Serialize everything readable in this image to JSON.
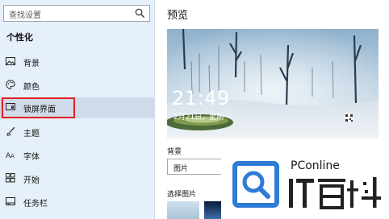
{
  "sidebar": {
    "search_placeholder": "查找设置",
    "section_title": "个性化",
    "items": [
      {
        "label": "背景",
        "icon": "image-icon"
      },
      {
        "label": "颜色",
        "icon": "palette-icon"
      },
      {
        "label": "锁屏界面",
        "icon": "lock-screen-icon",
        "selected": true
      },
      {
        "label": "主题",
        "icon": "brush-icon"
      },
      {
        "label": "字体",
        "icon": "font-icon"
      },
      {
        "label": "开始",
        "icon": "start-icon"
      },
      {
        "label": "任务栏",
        "icon": "taskbar-icon"
      }
    ]
  },
  "main": {
    "preview_title": "预览",
    "clock_time": "21:49",
    "clock_date": "2月21日，星期一",
    "background_label": "背景",
    "background_value": "图片",
    "choose_label": "选择图片"
  },
  "watermark": {
    "brand": "PConline",
    "accent_color": "#2e7cd6"
  },
  "colors": {
    "sidebar_bg": "#e6f0fa",
    "highlight": "#e02020"
  }
}
